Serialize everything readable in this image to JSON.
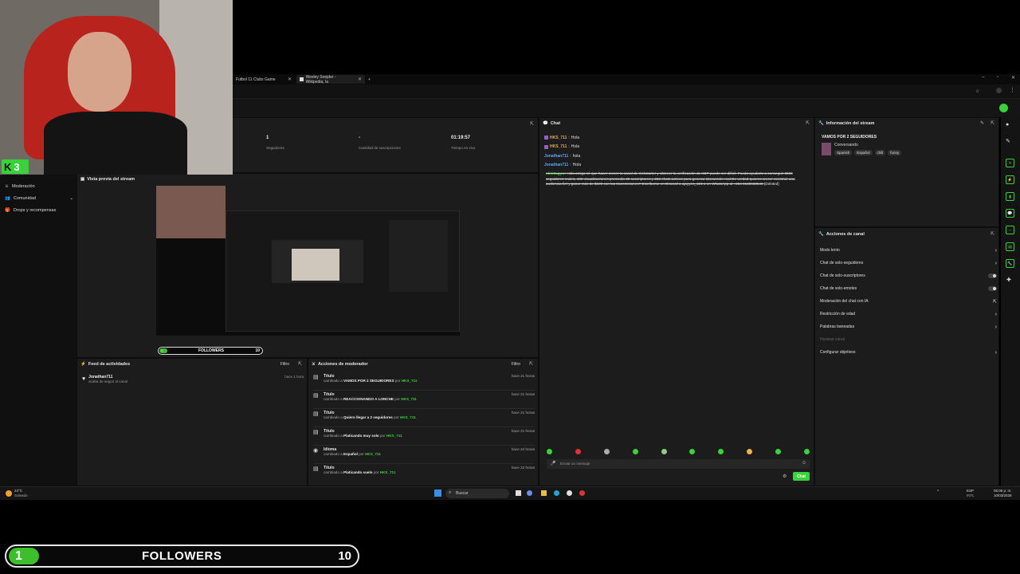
{
  "browser": {
    "tabs": [
      {
        "label": "Futbol 11 Clubs Game"
      },
      {
        "label": "Wesley Snejder - Wikipedia, la"
      }
    ],
    "new_tab": "+"
  },
  "dashboard": {
    "stats": [
      {
        "value": "1",
        "label": "Seguidores"
      },
      {
        "value": "-",
        "label": "Cantidad de suscripciones"
      },
      {
        "value": "01:19:57",
        "label": "Tiempo en vivo"
      }
    ],
    "sidebar": [
      {
        "label": "Moderación"
      },
      {
        "label": "Comunidad"
      },
      {
        "label": "Drops y recompensas"
      }
    ],
    "preview_title": "Vista previa del stream",
    "preview_followers": {
      "label": "FOLLOWERS",
      "current": "1",
      "goal": "10"
    }
  },
  "activity": {
    "title": "Feed de actividades",
    "filter": "Filtro",
    "items": [
      {
        "user": "Jonathan711",
        "desc": "acaba de seguir al canal",
        "time": "hace 1 hora"
      }
    ]
  },
  "mod_actions": {
    "title": "Acciones de moderador",
    "filter": "Filtro",
    "items": [
      {
        "title": "Título",
        "prefix": "cambiado a",
        "value": "VAMOS POR 2 SEGUIDORES",
        "by": "por",
        "user": "HKS_711",
        "time": "hace 21 horas"
      },
      {
        "title": "Título",
        "prefix": "cambiado a",
        "value": "REACCIONANDO A LONCHE",
        "by": "por",
        "user": "HKS_711",
        "time": "hace 21 horas"
      },
      {
        "title": "Título",
        "prefix": "cambiado a",
        "value": "Quiero llegar a 2 seguidores",
        "by": "por",
        "user": "HKS_711",
        "time": "hace 21 horas"
      },
      {
        "title": "Título",
        "prefix": "cambiado a",
        "value": "Platicando muy solo",
        "by": "por",
        "user": "HKS_711",
        "time": "hace 21 horas"
      },
      {
        "title": "Idioma",
        "prefix": "cambiado a",
        "value": "Español",
        "by": "por",
        "user": "HKS_711",
        "time": "hace 22 horas"
      },
      {
        "title": "Título",
        "prefix": "cambiado a",
        "value": "Platicando suelo",
        "by": "por",
        "user": "HKS_711",
        "time": "hace 22 horas"
      }
    ]
  },
  "chat": {
    "title": "Chat",
    "messages": [
      {
        "user": "HKS_711",
        "text": "Hola"
      },
      {
        "user": "HKS_711",
        "text": "Hola"
      },
      {
        "user": "Jonathan711",
        "text": "hola"
      },
      {
        "user": "Jonathan711",
        "text": "Hola"
      }
    ],
    "deleted": {
      "user": "nkni0ugyw",
      "text": "Hola amigo sé que hacer crecer tu canal de Kickstarter y obtener la verificación de KDP puede ser difícil. Puedo ayudarte a conseguir 3000 seguidores reales, 100 visualizaciones promedio 25 suscriptores y 250 chats activos para generar interacción real De verdad quieres crecer construir una audiencia fiel y ganar más de $100 con las transmisiones? Escríbeme en Discord a ajayyes_123 o en WhatsApp al +234 9138633546",
      "tag": "(Deleted)"
    },
    "placeholder": "Enviar un mensaje",
    "send_label": "Chat"
  },
  "stream_info": {
    "title": "Información del stream",
    "stream_title": "VAMOS POR 2 SEGUIDORES",
    "category": "Conversando",
    "tags": [
      "Spanish",
      "Español",
      "chill",
      "funny"
    ]
  },
  "channel_actions": {
    "title": "Acciones de canal",
    "items": [
      {
        "label": "Modo lento",
        "control": "chevron"
      },
      {
        "label": "Chat de solo-seguidores",
        "control": "chevron"
      },
      {
        "label": "Chat de solo-suscriptores",
        "control": "toggle"
      },
      {
        "label": "Chat de solo-emotes",
        "control": "toggle"
      },
      {
        "label": "Moderación del chat con IA",
        "control": "ext"
      },
      {
        "label": "Restricción de edad",
        "control": "chevron"
      },
      {
        "label": "Palabras baneadas",
        "control": "chevron"
      },
      {
        "label": "Hostear canal",
        "control": "none"
      },
      {
        "label": "Configurar objetivos",
        "control": "chevron"
      }
    ]
  },
  "taskbar": {
    "weather_temp": "24°C",
    "weather_desc": "Soleado",
    "search": "Buscar",
    "lang": "ESP",
    "lang2": "INTL",
    "time": "05:06 p. m.",
    "date": "10/03/2026"
  },
  "overlay": {
    "followers_label": "FOLLOWERS",
    "followers_current": "1",
    "followers_goal": "10",
    "kick_logo": "K",
    "kick_num": "3"
  },
  "colors": {
    "accent": "#3ad23a",
    "panel": "#1c1c1c",
    "bg": "#000000"
  }
}
